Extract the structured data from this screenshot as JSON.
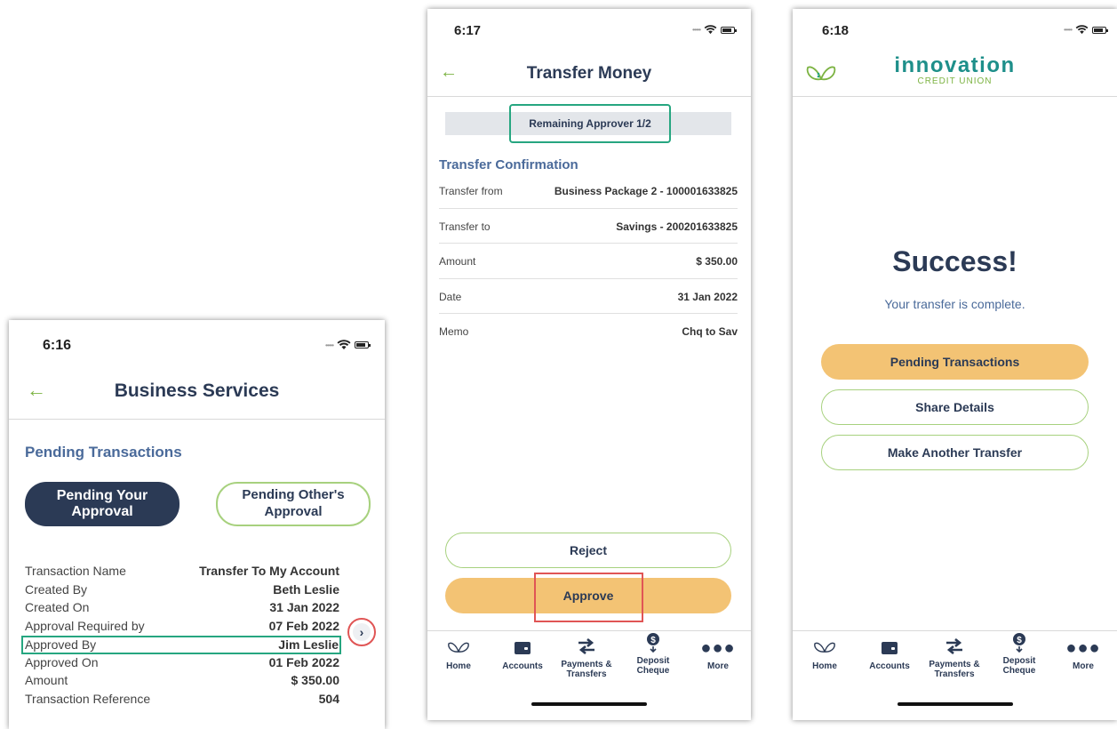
{
  "screen1": {
    "time": "6:16",
    "title": "Business Services",
    "section": "Pending Transactions",
    "tab_active": "Pending Your Approval",
    "tab_other": "Pending Other's Approval",
    "rows": [
      {
        "label": "Transaction Name",
        "value": "Transfer To My Account"
      },
      {
        "label": "Created By",
        "value": "Beth Leslie"
      },
      {
        "label": "Created On",
        "value": "31 Jan 2022"
      },
      {
        "label": "Approval Required by",
        "value": "07 Feb 2022"
      },
      {
        "label": "Approved By",
        "value": "Jim Leslie"
      },
      {
        "label": "Approved On",
        "value": "01 Feb 2022"
      },
      {
        "label": "Amount",
        "value": "$ 350.00"
      },
      {
        "label": "Transaction Reference",
        "value": "504"
      }
    ]
  },
  "screen2": {
    "time": "6:17",
    "title": "Transfer Money",
    "banner": "Remaining Approver 1/2",
    "section": "Transfer Confirmation",
    "rows": [
      {
        "label": "Transfer from",
        "value": "Business Package 2 - 100001633825"
      },
      {
        "label": "Transfer to",
        "value": "Savings - 200201633825"
      },
      {
        "label": "Amount",
        "value": "$ 350.00"
      },
      {
        "label": "Date",
        "value": "31 Jan 2022"
      },
      {
        "label": "Memo",
        "value": "Chq to Sav"
      }
    ],
    "reject_label": "Reject",
    "approve_label": "Approve"
  },
  "screen3": {
    "time": "6:18",
    "brand_name": "innovation",
    "brand_sub": "CREDIT UNION",
    "heading": "Success!",
    "message": "Your transfer is complete.",
    "btn_pending": "Pending Transactions",
    "btn_share": "Share Details",
    "btn_another": "Make Another Transfer"
  },
  "tabbar": {
    "home": "Home",
    "accounts": "Accounts",
    "payments_line1": "Payments &",
    "payments_line2": "Transfers",
    "deposit_line1": "Deposit",
    "deposit_line2": "Cheque",
    "more": "More"
  },
  "colors": {
    "navy": "#2b3a55",
    "green": "#7cb342",
    "orange": "#f3c374",
    "teal_highlight": "#26a680",
    "red_highlight": "#e05555"
  }
}
